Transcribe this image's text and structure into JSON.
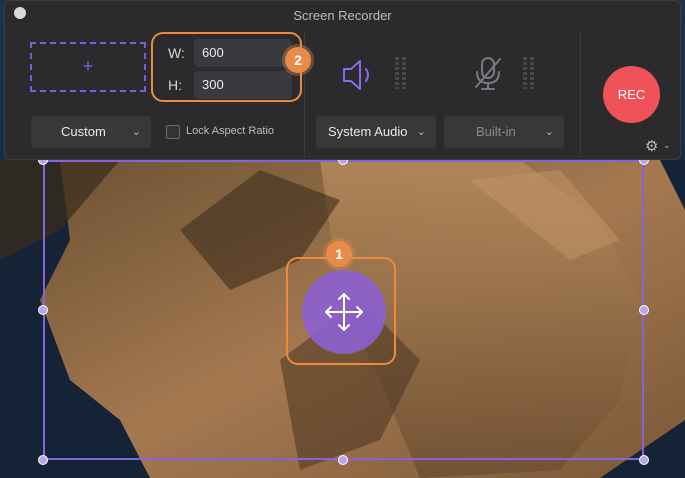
{
  "window": {
    "title": "Screen Recorder"
  },
  "area": {
    "add_label": "+",
    "preset": "Custom",
    "lock_aspect_label": "Lock Aspect Ratio"
  },
  "size": {
    "w_label": "W:",
    "w_value": "600",
    "h_label": "H:",
    "h_value": "300"
  },
  "audio": {
    "system_audio": "System Audio",
    "microphone": "Built-in"
  },
  "record": {
    "rec_label": "REC"
  },
  "callouts": {
    "one": "1",
    "two": "2"
  },
  "colors": {
    "accent_purple": "#7b5ce0",
    "callout_orange": "#ee8a3e",
    "rec_red": "#f0525a"
  },
  "icons": [
    "speaker-icon",
    "microphone-muted-icon",
    "gear-icon",
    "move-arrows-icon",
    "chevron-down-icon"
  ]
}
